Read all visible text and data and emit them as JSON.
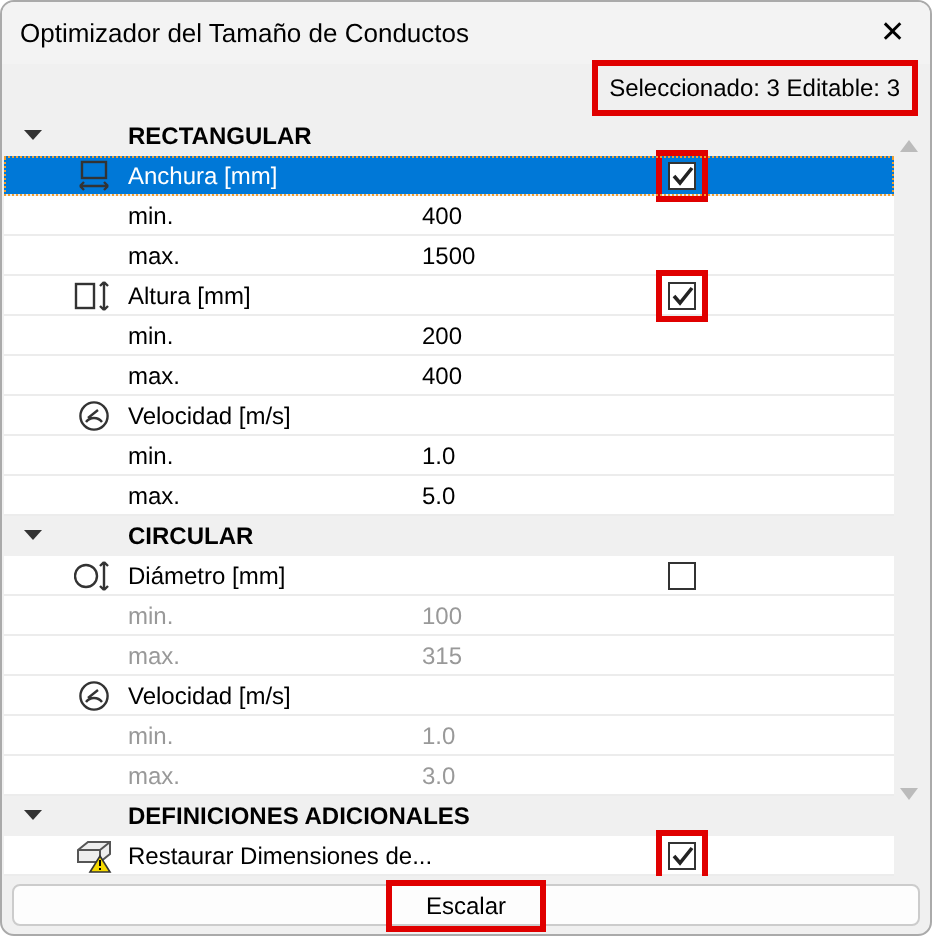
{
  "window": {
    "title": "Optimizador del Tamaño de Conductos",
    "close": "✕"
  },
  "status": {
    "text": "Seleccionado: 3 Editable: 3",
    "highlighted": true
  },
  "sections": [
    {
      "title": "RECTANGULAR",
      "expanded": true,
      "params": [
        {
          "kind": "width",
          "label": "Anchura [mm]",
          "checked": true,
          "highlighted": true,
          "selected": true,
          "disabled": false,
          "ranges": [
            {
              "label": "min.",
              "value": "400"
            },
            {
              "label": "max.",
              "value": "1500"
            }
          ]
        },
        {
          "kind": "height",
          "label": "Altura [mm]",
          "checked": true,
          "highlighted": true,
          "selected": false,
          "disabled": false,
          "ranges": [
            {
              "label": "min.",
              "value": "200"
            },
            {
              "label": "max.",
              "value": "400"
            }
          ]
        },
        {
          "kind": "velocity",
          "label": "Velocidad [m/s]",
          "selected": false,
          "disabled": false,
          "ranges": [
            {
              "label": "min.",
              "value": "1.0"
            },
            {
              "label": "max.",
              "value": "5.0"
            }
          ]
        }
      ]
    },
    {
      "title": "CIRCULAR",
      "expanded": true,
      "params": [
        {
          "kind": "diameter",
          "label": "Diámetro [mm]",
          "checked": false,
          "selected": false,
          "disabled": true,
          "ranges": [
            {
              "label": "min.",
              "value": "100"
            },
            {
              "label": "max.",
              "value": "315"
            }
          ]
        },
        {
          "kind": "velocity",
          "label": "Velocidad [m/s]",
          "selected": false,
          "disabled": true,
          "ranges": [
            {
              "label": "min.",
              "value": "1.0"
            },
            {
              "label": "max.",
              "value": "3.0"
            }
          ]
        }
      ]
    },
    {
      "title": "DEFINICIONES ADICIONALES",
      "expanded": true,
      "params": [
        {
          "kind": "restore",
          "label": "Restaurar Dimensiones de...",
          "checked": true,
          "highlighted": true,
          "selected": false
        }
      ]
    }
  ],
  "button": {
    "label": "Escalar",
    "highlighted": true
  }
}
